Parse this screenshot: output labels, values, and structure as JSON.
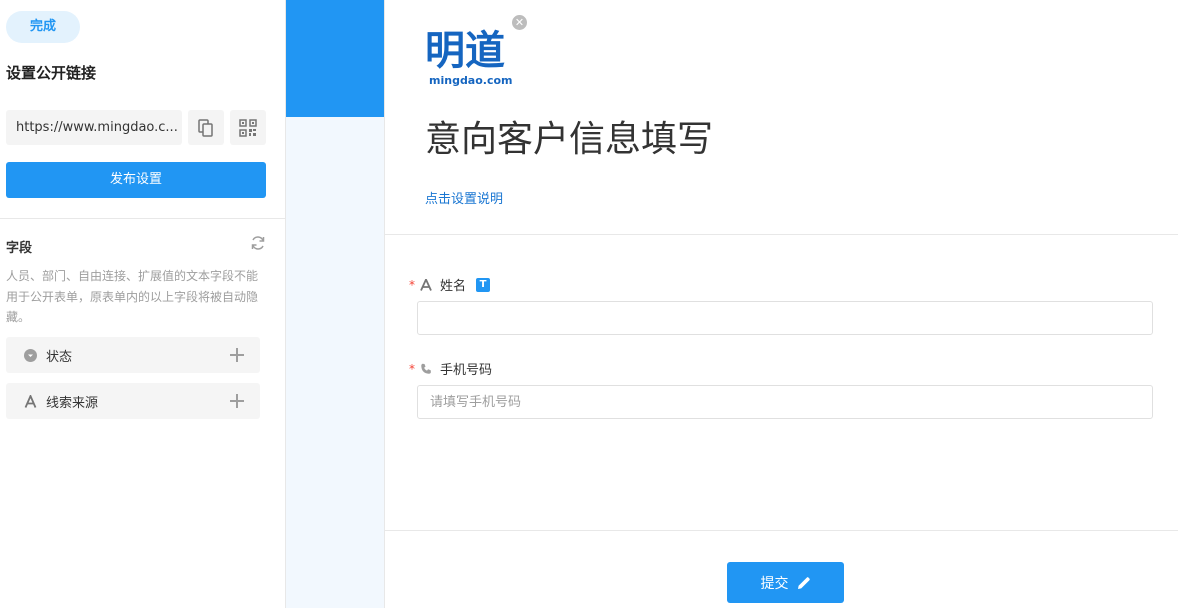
{
  "sidebar": {
    "done_label": "完成",
    "public_link_title": "设置公开链接",
    "url": "https://www.mingdao.c...",
    "publish_label": "发布设置",
    "fields_title": "字段",
    "fields_desc": "人员、部门、自由连接、扩展值的文本字段不能用于公开表单，原表单内的以上字段将被自动隐藏。",
    "hidden_fields": [
      {
        "label": "状态",
        "icon": "dropdown-circle-icon"
      },
      {
        "label": "线索来源",
        "icon": "text-icon"
      }
    ]
  },
  "form": {
    "logo_text": "明道",
    "logo_domain": "mingdao.com",
    "title": "意向客户信息填写",
    "description_link": "点击设置说明",
    "fields": [
      {
        "label": "姓名",
        "required": true,
        "icon": "text-icon",
        "badge": "T",
        "value": "",
        "placeholder": ""
      },
      {
        "label": "手机号码",
        "required": true,
        "icon": "phone-icon",
        "value": "",
        "placeholder": "请填写手机号码"
      }
    ],
    "submit_label": "提交"
  },
  "colors": {
    "accent": "#2196f3",
    "link": "#1976d2",
    "required": "#f44336",
    "logo": "#1565c0"
  }
}
